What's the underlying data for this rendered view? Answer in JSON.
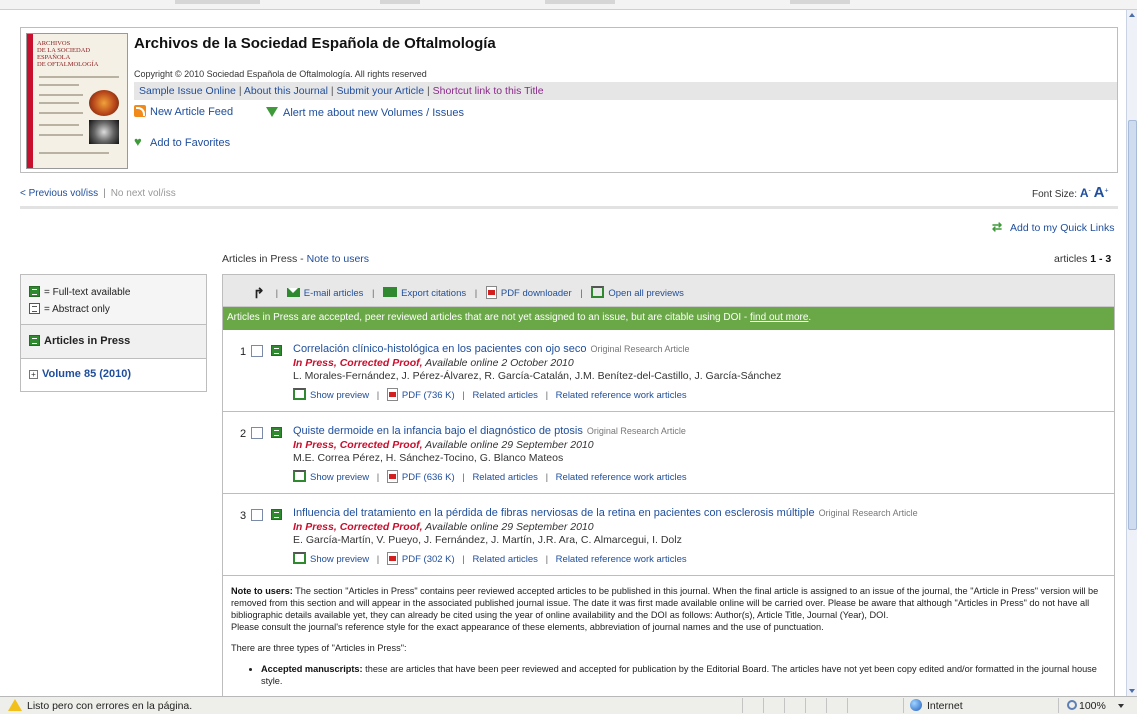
{
  "journal": {
    "title": "Archivos de la Sociedad Española de Oftalmología",
    "cover_text": [
      "ARCHIVOS",
      "DE LA SOCIEDAD",
      "ESPAÑOLA",
      "DE OFTALMOLOGÍA"
    ],
    "copyright": "Copyright © 2010 Sociedad Española de Oftalmología. All rights reserved",
    "links": [
      "Sample Issue Online",
      "About this Journal",
      "Submit your Article",
      "Shortcut link to this Title"
    ],
    "new_feed": "New Article Feed",
    "alert": "Alert me about new Volumes / Issues",
    "favorites": "Add to Favorites"
  },
  "nav": {
    "prev": "< Previous vol/iss",
    "sep": "|",
    "next": "No next vol/iss",
    "font_size_label": "Font Size:",
    "font_small": "A",
    "font_big": "A",
    "quick_links": "Add to my Quick Links"
  },
  "aip": {
    "title": "Articles in Press - ",
    "note_link": "Note to users",
    "count_label": "articles ",
    "count_value": "1 - 3"
  },
  "left_panel": {
    "legend_full": "= Full-text available",
    "legend_abstract": "= Abstract only",
    "articles_in_press": "Articles in Press",
    "volume": "Volume 85 (2010)"
  },
  "toolbar": {
    "email": "E-mail articles",
    "export": "Export citations",
    "pdf_downloader": "PDF downloader",
    "open_previews": "Open all previews"
  },
  "banner": {
    "text": "Articles in Press are accepted, peer reviewed articles that are not yet assigned to an issue, but are citable using DOI - ",
    "link": "find out more",
    "end": "."
  },
  "articles": [
    {
      "num": "1",
      "title": "Correlación clínico-histológica en los pacientes con ojo seco",
      "type": "Original Research Article",
      "status": "In Press, Corrected Proof,",
      "available": " Available online 2 October 2010",
      "authors": "L. Morales-Fernández, J. Pérez-Álvarez, R. García-Catalán, J.M. Benítez-del-Castillo, J. García-Sánchez",
      "show_preview": "Show preview",
      "pdf": "PDF (736 K)",
      "related": "Related articles",
      "related_ref": "Related reference work articles"
    },
    {
      "num": "2",
      "title": "Quiste dermoide en la infancia bajo el diagnóstico de ptosis",
      "type": "Original Research Article",
      "status": "In Press, Corrected Proof,",
      "available": " Available online 29 September 2010",
      "authors": "M.E. Correa Pérez, H. Sánchez-Tocino, G. Blanco Mateos",
      "show_preview": "Show preview",
      "pdf": "PDF (636 K)",
      "related": "Related articles",
      "related_ref": "Related reference work articles"
    },
    {
      "num": "3",
      "title": "Influencia del tratamiento en la pérdida de fibras nerviosas de la retina en pacientes con esclerosis múltiple",
      "type": "Original Research Article",
      "status": "In Press, Corrected Proof,",
      "available": " Available online 29 September 2010",
      "authors": "E. García-Martín, V. Pueyo, J. Fernández, J. Martín, J.R. Ara, C. Almarcegui, I. Dolz",
      "show_preview": "Show preview",
      "pdf": "PDF (302 K)",
      "related": "Related articles",
      "related_ref": "Related reference work articles"
    }
  ],
  "note": {
    "label": "Note to users:",
    "p1": " The section \"Articles in Press\" contains peer reviewed accepted articles to be published in this journal. When the final article is assigned to an issue of the journal, the \"Article in Press\" version will be removed from this section and will appear in the associated published journal issue. The date it was first made available online will be carried over. Please be aware that although \"Articles in Press\" do not have all bibliographic details available yet, they can already be cited using the year of online availability and the DOI as follows: Author(s), Article Title, Journal (Year), DOI.",
    "p1b": "Please consult the journal's reference style for the exact appearance of these elements, abbreviation of journal names and the use of punctuation.",
    "p2": "There are three types of \"Articles in Press\":",
    "li_label": "Accepted manuscripts:",
    "li_text": " these are articles that have been peer reviewed and accepted for publication by the Editorial Board. The articles have not yet been copy edited and/or formatted in the journal house style."
  },
  "statusbar": {
    "message": "Listo pero con errores en la página.",
    "zone": "Internet",
    "zoom": "100%"
  },
  "colors": {
    "link": "#1f4e9c",
    "banner_green": "#6aa746",
    "in_press_red": "#c8102e"
  }
}
